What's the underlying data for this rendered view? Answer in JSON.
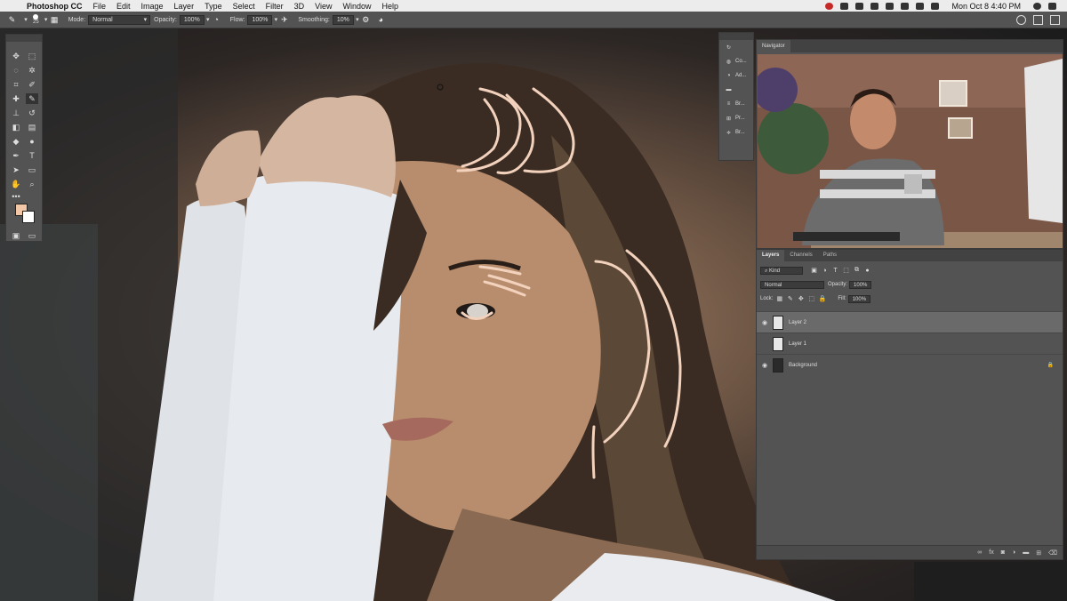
{
  "menubar": {
    "app": "Photoshop CC",
    "items": [
      "File",
      "Edit",
      "Image",
      "Layer",
      "Type",
      "Select",
      "Filter",
      "3D",
      "View",
      "Window",
      "Help"
    ],
    "clock": "Mon Oct 8  4:40 PM"
  },
  "options": {
    "brush_size": "25",
    "mode_label": "Mode:",
    "mode_value": "Normal",
    "opacity_label": "Opacity:",
    "opacity_value": "100%",
    "flow_label": "Flow:",
    "flow_value": "100%",
    "smoothing_label": "Smoothing:",
    "smoothing_value": "10%"
  },
  "colors": {
    "foreground": "#f1c7a8",
    "background": "#ffffff",
    "stroke": "#f3d2bd"
  },
  "minipanel": {
    "items": [
      {
        "icon": "history-icon",
        "label": ""
      },
      {
        "icon": "color-icon",
        "label": "Co..."
      },
      {
        "icon": "adjustments-icon",
        "label": "Ad..."
      },
      {
        "icon": "ruler-icon",
        "label": ""
      },
      {
        "icon": "brushes-icon",
        "label": "Br..."
      },
      {
        "icon": "presets-icon",
        "label": "Pr..."
      },
      {
        "icon": "brush-settings-icon",
        "label": "Br..."
      }
    ]
  },
  "navigator": {
    "title": "Navigator"
  },
  "layers": {
    "tabs": [
      "Layers",
      "Channels",
      "Paths"
    ],
    "filter_kind": "Kind",
    "blend_mode": "Normal",
    "opacity_label": "Opacity:",
    "opacity_value": "100%",
    "lock_label": "Lock:",
    "fill_label": "Fill:",
    "fill_value": "100%",
    "items": [
      {
        "name": "Layer 2",
        "visible": true,
        "selected": true
      },
      {
        "name": "Layer 1",
        "visible": false,
        "selected": false
      },
      {
        "name": "Background",
        "visible": true,
        "selected": false,
        "locked": true
      }
    ]
  }
}
